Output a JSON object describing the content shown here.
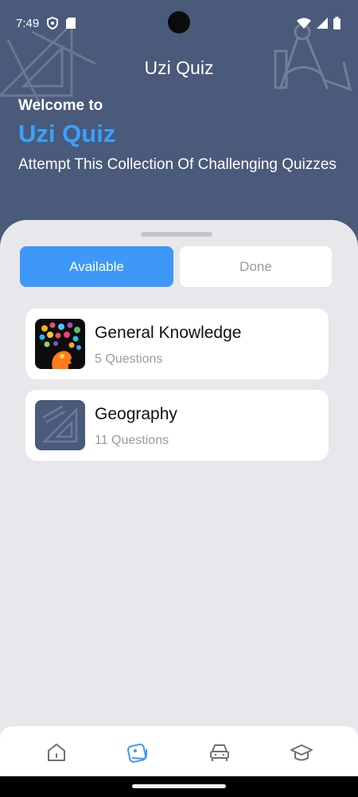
{
  "status_bar": {
    "time": "7:49"
  },
  "header": {
    "app_title": "Uzi Quiz",
    "welcome": "Welcome to",
    "brand": "Uzi Quiz",
    "tagline": "Attempt This Collection Of Challenging Quizzes"
  },
  "tabs": [
    {
      "label": "Available",
      "selected": true
    },
    {
      "label": "Done",
      "selected": false
    }
  ],
  "quizzes": [
    {
      "title": "General Knowledge",
      "subtitle": "5 Questions",
      "icon": "brain-icon"
    },
    {
      "title": "Geography",
      "subtitle": "11 Questions",
      "icon": "ruler-icon"
    }
  ],
  "bottom_nav": [
    {
      "icon": "home-icon",
      "active": false
    },
    {
      "icon": "quiz-icon",
      "active": true
    },
    {
      "icon": "car-icon",
      "active": false
    },
    {
      "icon": "graduation-cap-icon",
      "active": false
    }
  ],
  "colors": {
    "header_bg": "#4a5a7a",
    "accent": "#3d98f8",
    "brand": "#3aa0ff",
    "background": "#e8e8ec"
  }
}
